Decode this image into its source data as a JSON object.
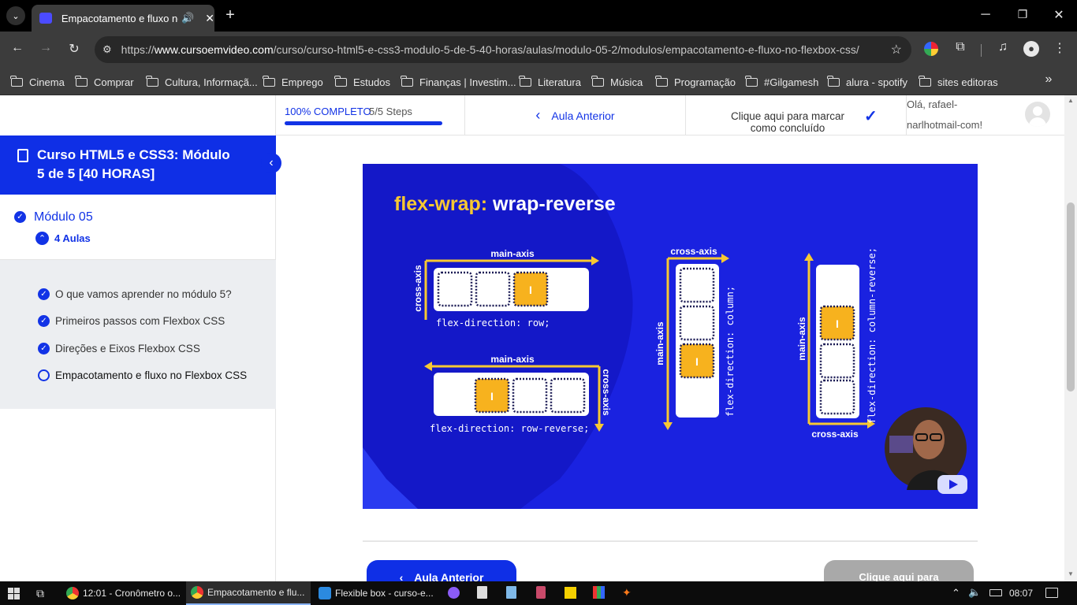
{
  "browser": {
    "tab_title": "Empacotamento e fluxo no",
    "url_prefix": "https://",
    "url_domain": "www.cursoemvideo.com",
    "url_path": "/curso/curso-html5-e-css3-modulo-5-de-5-40-horas/aulas/modulo-05-2/modulos/empacotamento-e-fluxo-no-flexbox-css/",
    "bookmarks": [
      "Cinema",
      "Comprar",
      "Cultura, Informaçã...",
      "Emprego",
      "Estudos",
      "Finanças | Investim...",
      "Literatura",
      "Música",
      "Programação",
      "#Gilgamesh",
      "alura - spotify",
      "sites editoras"
    ]
  },
  "topbar": {
    "progress_label": "100% COMPLETO",
    "steps": "5/5 Steps",
    "progress_fraction": 1.0,
    "prev_lesson": "Aula Anterior",
    "mark_complete": "Clique aqui para marcar como concluído",
    "greeting_line1": "Olá, rafael-",
    "greeting_line2": "narlhotmail-com!"
  },
  "sidebar": {
    "course_title_line1": "Curso HTML5 e CSS3: Módulo",
    "course_title_line2": "5 de 5 [40 HORAS]",
    "module_title": "Módulo 05",
    "lessons_count": "4 Aulas",
    "lessons": [
      {
        "label": "O que vamos aprender no módulo 5?",
        "done": true
      },
      {
        "label": "Primeiros passos com Flexbox CSS",
        "done": true
      },
      {
        "label": "Direções e Eixos Flexbox CSS",
        "done": true
      },
      {
        "label": "Empacotamento e fluxo no Flexbox CSS",
        "done": false
      }
    ]
  },
  "video": {
    "title_prop": "flex-wrap",
    "title_colon": ":",
    "title_value": " wrap-reverse",
    "main_axis": "main-axis",
    "cross_axis": "cross-axis",
    "item_label": "I",
    "code_row": "flex-direction: row;",
    "code_row_reverse": "flex-direction: row-reverse;",
    "code_column": "flex-direction: column;",
    "code_column_reverse": "flex-direction: column-reverse;"
  },
  "bottom": {
    "prev_button": "Aula Anterior",
    "mark_button": "Clique aqui para"
  },
  "taskbar": {
    "item1": "12:01 - Cronômetro o...",
    "item2": "Empacotamento e flu...",
    "item3": "Flexible box - curso-e...",
    "clock": "08:07"
  },
  "colors": {
    "brand_blue": "#1233e6",
    "video_bg": "#1a22e0",
    "accent_yellow": "#f7c832"
  }
}
